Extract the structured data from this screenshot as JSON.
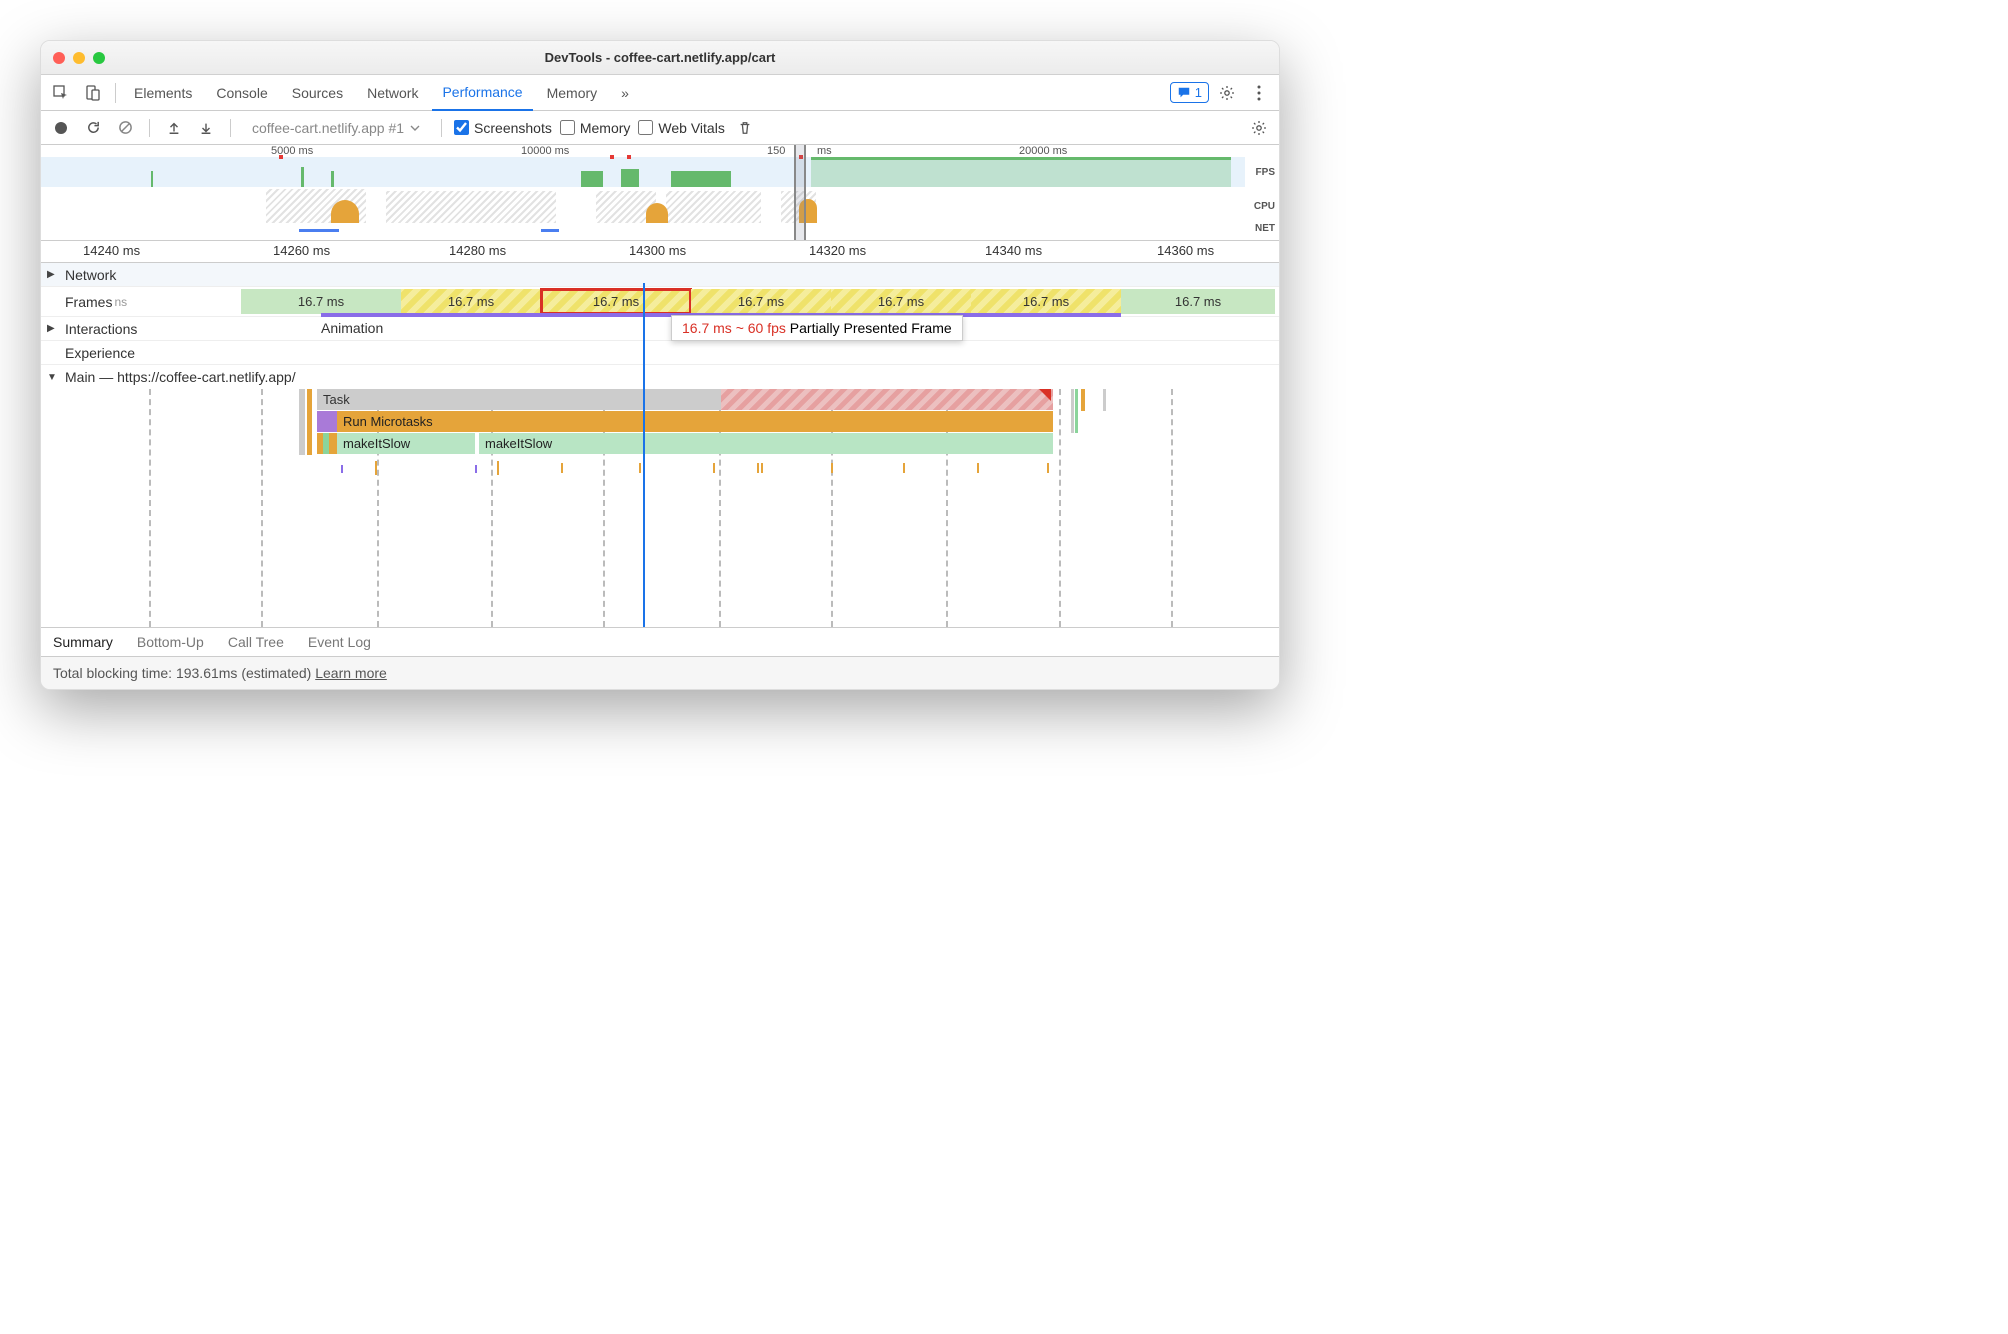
{
  "window": {
    "title": "DevTools - coffee-cart.netlify.app/cart"
  },
  "tabs": {
    "items": [
      "Elements",
      "Console",
      "Sources",
      "Network",
      "Performance",
      "Memory"
    ],
    "active": "Performance",
    "overflow": "»",
    "feedback_count": "1"
  },
  "toolbar": {
    "recording_name": "coffee-cart.netlify.app #1",
    "checkboxes": {
      "screenshots": "Screenshots",
      "memory": "Memory",
      "webvitals": "Web Vitals"
    }
  },
  "overview": {
    "ticks": [
      "5000 ms",
      "10000 ms",
      "150",
      "ms",
      "20000 ms"
    ],
    "labels": {
      "fps": "FPS",
      "cpu": "CPU",
      "net": "NET"
    }
  },
  "ruler": {
    "ticks": [
      "14240 ms",
      "14260 ms",
      "14280 ms",
      "14300 ms",
      "14320 ms",
      "14340 ms",
      "14360 ms"
    ]
  },
  "tracks": {
    "network": "Network",
    "frames_label": "Frames",
    "frames_hint": "ns",
    "frames": [
      "16.7 ms",
      "16.7 ms",
      "16.7 ms",
      "16.7 ms",
      "16.7 ms",
      "16.7 ms",
      "16.7 ms"
    ],
    "interactions": "Interactions",
    "interactions_event": "Animation",
    "experience": "Experience",
    "main": "Main — https://coffee-cart.netlify.app/"
  },
  "tooltip": {
    "timing": "16.7 ms ~ 60 fps",
    "status": "Partially Presented Frame"
  },
  "flame": {
    "task": "Task",
    "microtasks": "Run Microtasks",
    "fn1": "makeItSlow",
    "fn2": "makeItSlow"
  },
  "bottom_tabs": [
    "Summary",
    "Bottom-Up",
    "Call Tree",
    "Event Log"
  ],
  "footer": {
    "text": "Total blocking time: 193.61ms (estimated)",
    "link": "Learn more"
  }
}
